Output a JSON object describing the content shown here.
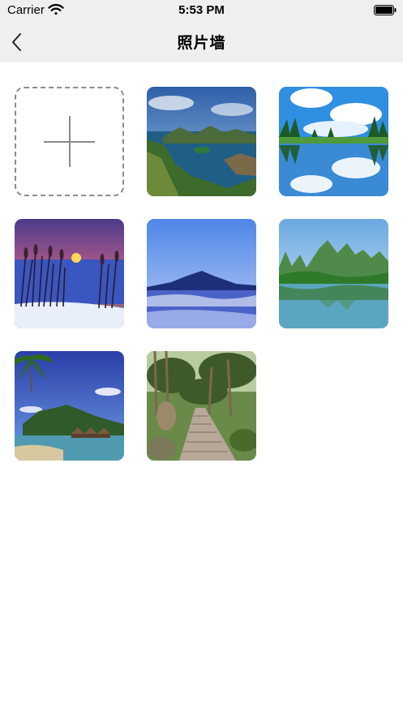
{
  "status_bar": {
    "carrier": "Carrier",
    "time": "5:53 PM",
    "icons": [
      "wifi-icon",
      "battery-icon"
    ]
  },
  "nav": {
    "title": "照片墙",
    "back_icon": "chevron-left-icon"
  },
  "grid": {
    "add_icon": "plus-icon",
    "photos": [
      {
        "subject": "fjord-landscape"
      },
      {
        "subject": "mirror-lake"
      },
      {
        "subject": "reeds-sunset"
      },
      {
        "subject": "misty-mountain"
      },
      {
        "subject": "karst-river"
      },
      {
        "subject": "tropical-bungalows"
      },
      {
        "subject": "forest-stone-path"
      }
    ]
  },
  "colors": {
    "bar_background": "#efefef",
    "page_background": "#ffffff",
    "dashed_border": "#8c8c8c"
  }
}
